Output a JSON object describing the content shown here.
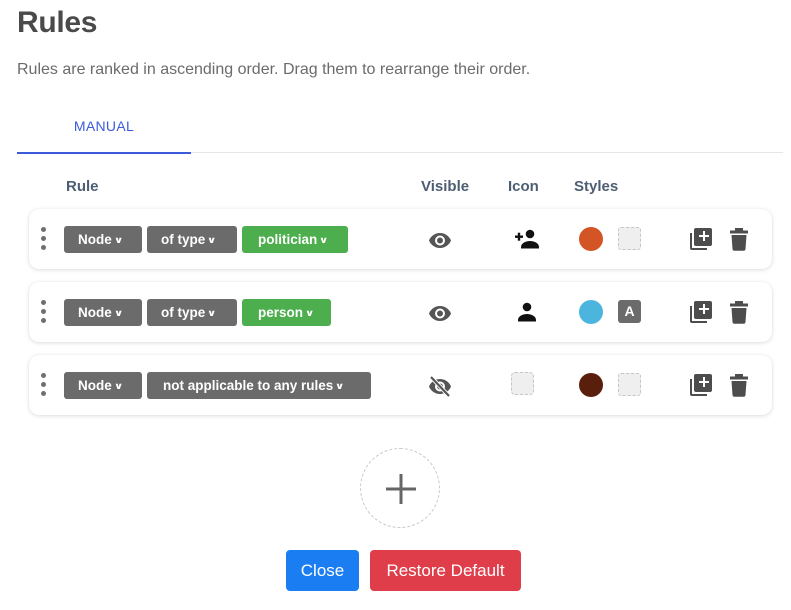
{
  "header": {
    "title": "Rules",
    "subtitle": "Rules are ranked in ascending order. Drag them to rearrange their order."
  },
  "tabs": [
    {
      "label": "MANUAL",
      "active": true
    }
  ],
  "columns": {
    "rule": "Rule",
    "visible": "Visible",
    "icon": "Icon",
    "styles": "Styles"
  },
  "rules": [
    {
      "selectors": [
        "Node",
        "of type",
        "politician"
      ],
      "visible": true,
      "icon": "person-add-icon",
      "color": "#d35424",
      "font_badge": ""
    },
    {
      "selectors": [
        "Node",
        "of type",
        "person"
      ],
      "visible": true,
      "icon": "person-icon",
      "color": "#4bb5de",
      "font_badge": "A"
    },
    {
      "selectors": [
        "Node",
        "not applicable to any rules"
      ],
      "visible": false,
      "icon": "",
      "color": "#5a1e0c",
      "font_badge": ""
    }
  ],
  "footer": {
    "close_label": "Close",
    "restore_label": "Restore Default"
  },
  "theme": {
    "accent": "#3b5bdb",
    "selector_gray": "#6b6b6b",
    "selector_green": "#4cae4c",
    "close_button": "#1a7df2",
    "restore_button": "#df3d4a"
  }
}
